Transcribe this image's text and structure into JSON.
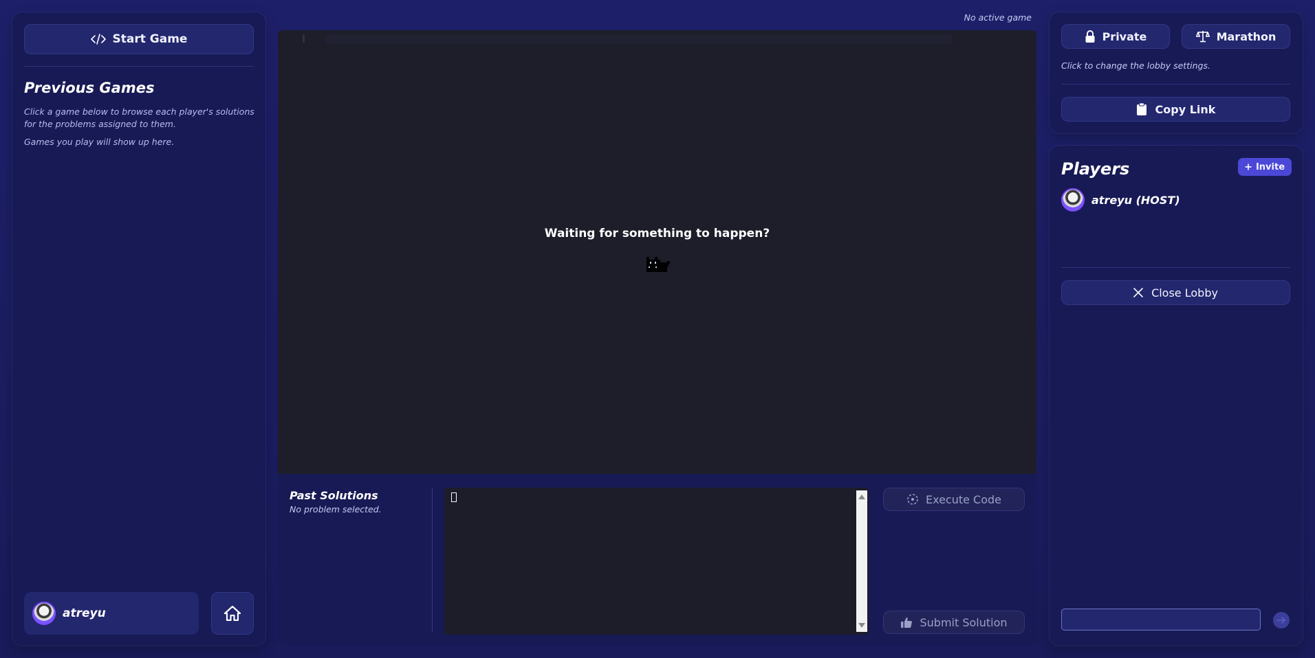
{
  "left": {
    "start_game_label": "Start Game",
    "previous_games_title": "Previous Games",
    "previous_games_desc": "Click a game below to browse each player's solutions for the problems assigned to them.",
    "previous_games_empty": "Games you play will show up here.",
    "user_name": "atreyu"
  },
  "center": {
    "status": "No active game",
    "waiting_message": "Waiting for something to happen?",
    "past_solutions_title": "Past Solutions",
    "past_solutions_sub": "No problem selected.",
    "execute_label": "Execute Code",
    "submit_label": "Submit Solution"
  },
  "lobby": {
    "private_label": "Private",
    "marathon_label": "Marathon",
    "settings_hint": "Click to change the lobby settings.",
    "copy_link_label": "Copy Link"
  },
  "players": {
    "title": "Players",
    "invite_label": "Invite",
    "list": [
      {
        "name": "atreyu (HOST)"
      }
    ],
    "close_lobby_label": "Close Lobby",
    "chat_placeholder": ""
  },
  "colors": {
    "background": "#1a1c5e",
    "panel": "#181a55",
    "button": "#23276e",
    "editor": "#1d1e2a",
    "accent": "#4b48d8"
  },
  "icons": [
    "code-icon",
    "home-icon",
    "lock-icon",
    "scale-icon",
    "clipboard-icon",
    "plus-icon",
    "close-icon",
    "cat-icon",
    "execute-icon",
    "thumbs-up-icon",
    "send-icon"
  ]
}
